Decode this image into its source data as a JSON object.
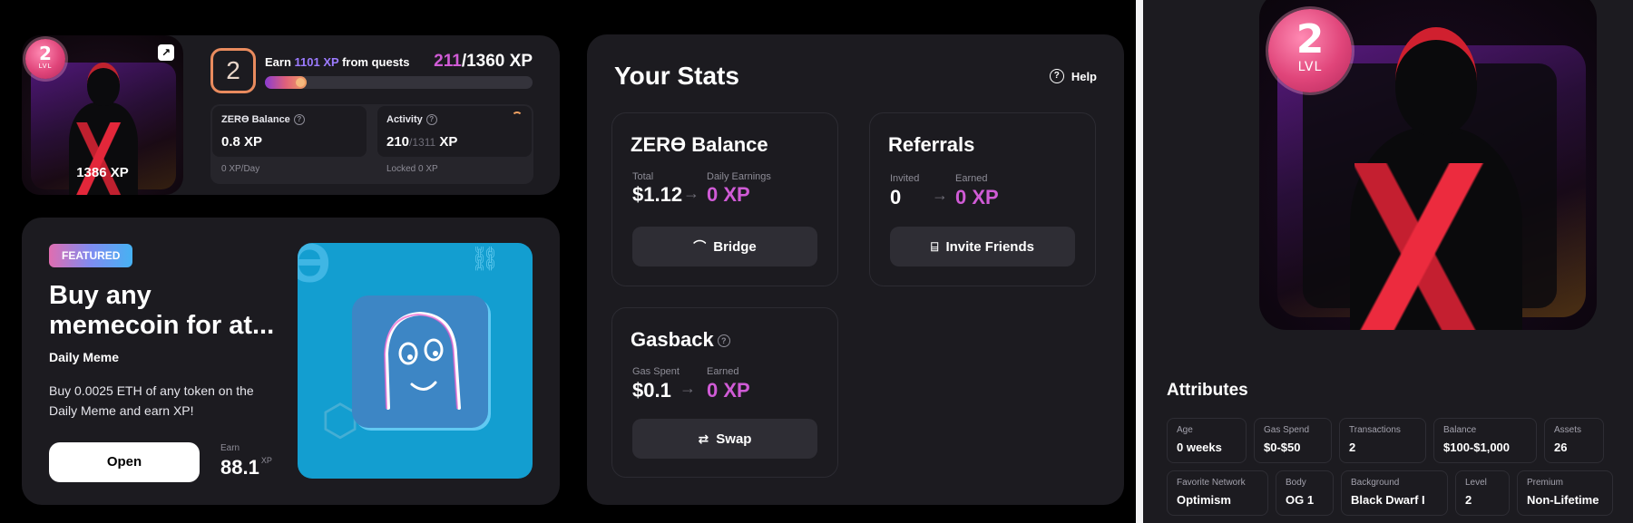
{
  "profile": {
    "level": "2",
    "level_label": "LVL",
    "avatar_xp": "1386 XP",
    "quest_prefix": "Earn",
    "quest_xp": "1101 XP",
    "quest_suffix": "from quests",
    "xp_current": "211",
    "xp_total": "/1360 XP",
    "progress_fraction": 0.155,
    "balance": {
      "title": "ZERϴ Balance",
      "value": "0.8 XP",
      "footer": "0 XP/Day"
    },
    "activity": {
      "title": "Activity",
      "value": "210",
      "value_dim": "/1311",
      "value_unit": "XP",
      "footer": "Locked 0 XP"
    }
  },
  "featured": {
    "tag": "FEATURED",
    "title": "Buy any memecoin for at...",
    "subtitle": "Daily Meme",
    "description": "Buy 0.0025 ETH of any token on the Daily Meme and earn XP!",
    "open_label": "Open",
    "earn_label": "Earn",
    "earn_value": "88.1",
    "earn_unit": "XP"
  },
  "stats": {
    "title": "Your Stats",
    "help_label": "Help",
    "zero_balance": {
      "title": "ZERϴ Balance",
      "left_label": "Total",
      "left_value": "$1.12",
      "right_label": "Daily Earnings",
      "right_value": "0 XP",
      "button": "Bridge"
    },
    "referrals": {
      "title": "Referrals",
      "left_label": "Invited",
      "left_value": "0",
      "right_label": "Earned",
      "right_value": "0 XP",
      "button": "Invite Friends"
    },
    "gasback": {
      "title": "Gasback",
      "left_label": "Gas Spent",
      "left_value": "$0.1",
      "right_label": "Earned",
      "right_value": "0 XP",
      "button": "Swap"
    }
  },
  "nft": {
    "level": "2",
    "level_label": "LVL",
    "attributes_title": "Attributes",
    "attributes": [
      {
        "key": "Age",
        "value": "0 weeks"
      },
      {
        "key": "Gas Spend",
        "value": "$0-$50"
      },
      {
        "key": "Transactions",
        "value": "2"
      },
      {
        "key": "Balance",
        "value": "$100-$1,000"
      },
      {
        "key": "Assets",
        "value": "26"
      },
      {
        "key": "Favorite Network",
        "value": "Optimism"
      },
      {
        "key": "Body",
        "value": "OG 1"
      },
      {
        "key": "Background",
        "value": "Black Dwarf I"
      },
      {
        "key": "Level",
        "value": "2"
      },
      {
        "key": "Premium",
        "value": "Non-Lifetime"
      }
    ]
  },
  "colors": {
    "accent_purple": "#d05bd6",
    "accent_violet": "#9c7bff",
    "card_bg": "#1c1b20",
    "featured_image_bg": "#139ed0"
  },
  "icons": [
    "expand-icon",
    "help-icon",
    "arrow-right-icon",
    "bridge-icon",
    "gift-icon",
    "swap-icon",
    "chain-icon",
    "cubes-icon"
  ]
}
